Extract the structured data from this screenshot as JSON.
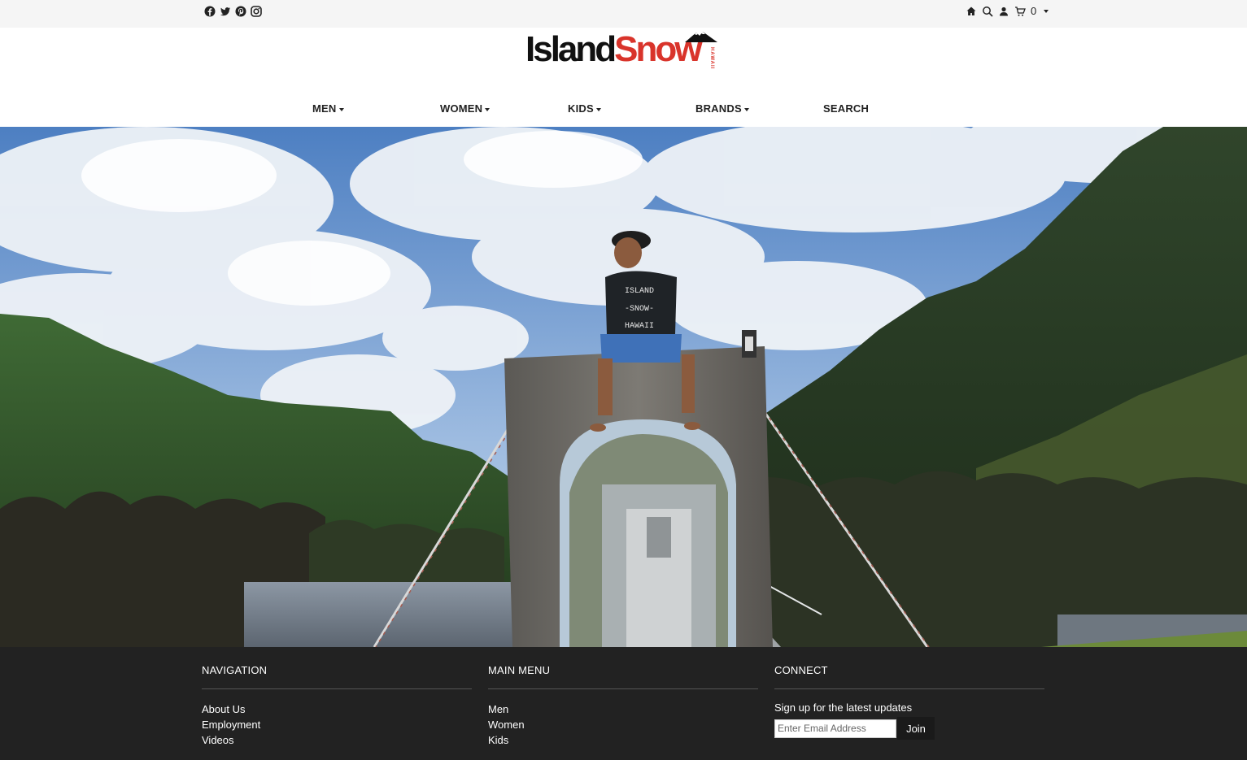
{
  "topbar": {
    "social_icons": [
      "facebook-icon",
      "twitter-icon",
      "pinterest-icon",
      "instagram-icon"
    ],
    "utility_icons": [
      "home-icon",
      "search-icon",
      "account-icon",
      "cart-icon"
    ],
    "cart_count": "0"
  },
  "logo": {
    "part1": "Island",
    "part2": "Snow",
    "sub": "HAWAII",
    "colors": {
      "dark": "#111111",
      "red": "#d9342b"
    }
  },
  "nav": {
    "items": [
      "MEN",
      "WOMEN",
      "KIDS",
      "BRANDS",
      "SEARCH"
    ]
  },
  "hero": {
    "description_icon": "hero-image",
    "shirt_text": [
      "ISLAND",
      "-SNOW-",
      "HAWAII"
    ]
  },
  "footer": {
    "navigation": {
      "heading": "NAVIGATION",
      "links": [
        "About Us",
        "Employment",
        "Videos"
      ]
    },
    "main_menu": {
      "heading": "MAIN MENU",
      "links": [
        "Men",
        "Women",
        "Kids"
      ]
    },
    "connect": {
      "heading": "CONNECT",
      "signup_label": "Sign up for the latest updates",
      "email_placeholder": "Enter Email Address",
      "join_label": "Join"
    },
    "bg_color": "#222222"
  }
}
